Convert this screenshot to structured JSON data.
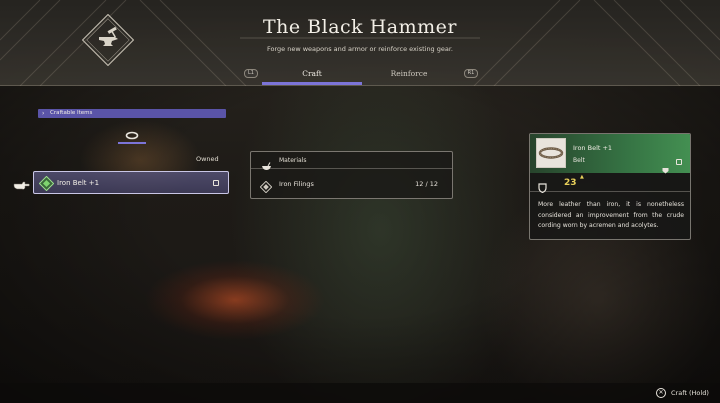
{
  "header": {
    "title": "The Black Hammer",
    "subtitle": "Forge new weapons and armor or reinforce existing gear.",
    "emblem_icon": "anvil-hammer-icon"
  },
  "tabs": [
    {
      "label": "Craft",
      "active": true,
      "button_hint": "L1"
    },
    {
      "label": "Reinforce",
      "active": false,
      "button_hint": "R1"
    }
  ],
  "list": {
    "section_label": "Craftable Items",
    "category_icon": "belt-ring-icon",
    "owned_label": "Owned",
    "items": [
      {
        "name": "Iron Belt +1",
        "selected": true,
        "icon": "gem-icon"
      }
    ]
  },
  "materials": {
    "header_label": "Materials",
    "rows": [
      {
        "name": "Iron Filings",
        "count": "12 / 12",
        "icon": "diamond-material-icon"
      }
    ]
  },
  "detail": {
    "name": "Iron Belt +1",
    "type": "Belt",
    "stat_value": "23",
    "stat_icon": "defense-shield-icon",
    "description": "More leather than iron, it is nonetheless considered an improvement from the crude cording worn by acremen and acolytes."
  },
  "footer": {
    "button_glyph": "✕",
    "action_label": "Craft (Hold)"
  },
  "colors": {
    "accent": "#7c74d8",
    "section_bar": "#5a54a8",
    "stat_up": "#e8d05a",
    "card_green": "#46965a"
  }
}
